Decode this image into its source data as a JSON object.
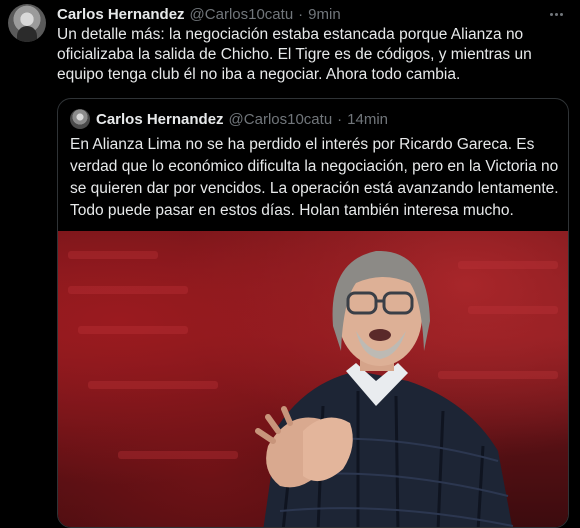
{
  "tweet": {
    "author_name": "Carlos Hernandez",
    "handle": "@Carlos10catu",
    "separator": "·",
    "time": "9min",
    "text": "Un detalle más: la negociación estaba estancada porque Alianza no oficializaba la salida de Chicho. El Tigre es de códigos, y mientras un equipo tenga club él no iba a negociar. Ahora todo cambia."
  },
  "quoted_tweet": {
    "author_name": "Carlos Hernandez",
    "handle": "@Carlos10catu",
    "separator": "·",
    "time": "14min",
    "text": "En Alianza Lima no se ha perdido el interés por Ricardo Gareca. Es verdad que lo económico dificulta la negociación, pero en la Victoria no se quieren dar por vencidos. La operación está avanzando lentamente. Todo puede pasar en estos días. Holan también interesa mucho."
  },
  "colors": {
    "background": "#000000",
    "text": "#e7e9ea",
    "secondary": "#71767b",
    "border": "#2f3336"
  },
  "icons": {
    "more": "more-horizontal-icon"
  }
}
